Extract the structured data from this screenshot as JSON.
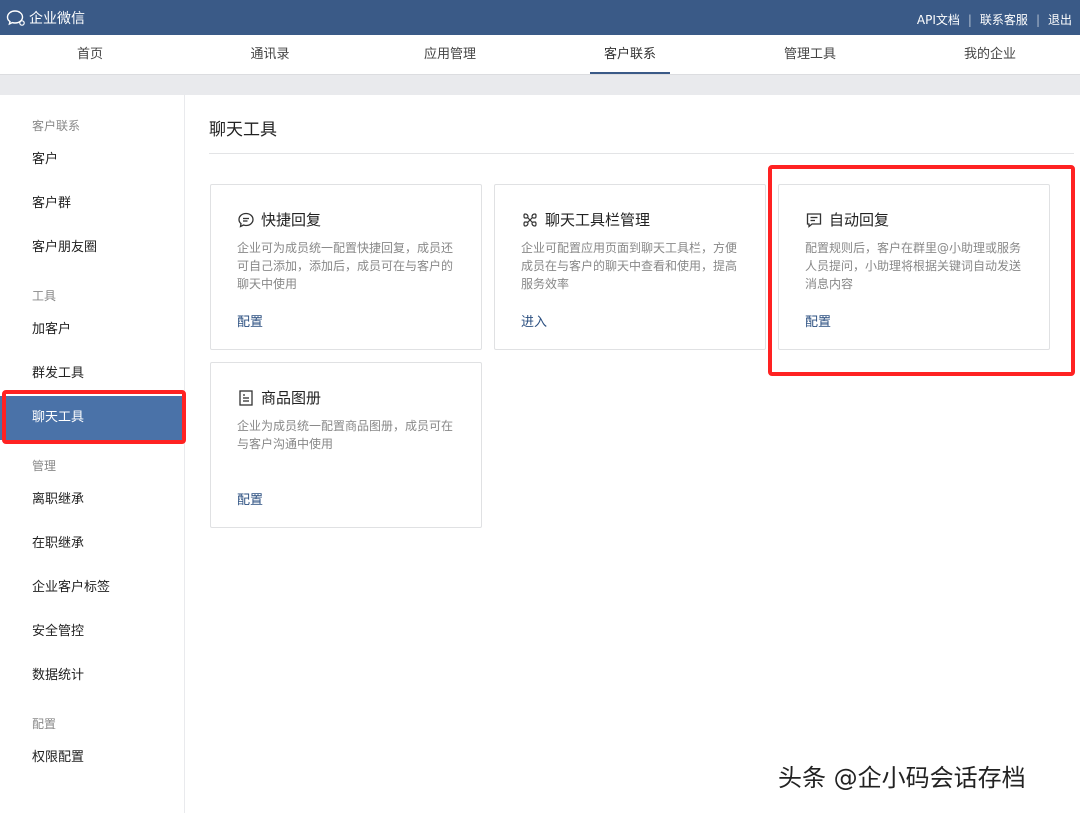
{
  "topbar": {
    "brand": "企业微信",
    "links": [
      "API文档",
      "联系客服",
      "退出"
    ]
  },
  "nav": {
    "items": [
      "首页",
      "通讯录",
      "应用管理",
      "客户联系",
      "管理工具",
      "我的企业"
    ],
    "active": "客户联系"
  },
  "sidebar": {
    "sections": [
      {
        "title": "客户联系",
        "items": [
          "客户",
          "客户群",
          "客户朋友圈"
        ]
      },
      {
        "title": "工具",
        "items": [
          "加客户",
          "群发工具",
          "聊天工具"
        ]
      },
      {
        "title": "管理",
        "items": [
          "离职继承",
          "在职继承",
          "企业客户标签",
          "安全管控",
          "数据统计"
        ]
      },
      {
        "title": "配置",
        "items": [
          "权限配置"
        ]
      }
    ],
    "active": "聊天工具"
  },
  "main": {
    "title": "聊天工具",
    "cards": [
      {
        "icon": "quick-reply-icon",
        "title": "快捷回复",
        "desc": "企业可为成员统一配置快捷回复，成员还可自己添加，添加后，成员可在与客户的聊天中使用",
        "action": "配置"
      },
      {
        "icon": "toolbar-icon",
        "title": "聊天工具栏管理",
        "desc": "企业可配置应用页面到聊天工具栏，方便成员在与客户的聊天中查看和使用，提高服务效率",
        "action": "进入"
      },
      {
        "icon": "auto-reply-icon",
        "title": "自动回复",
        "desc": "配置规则后，客户在群里@小助理或服务人员提问，小助理将根据关键词自动发送消息内容",
        "action": "配置"
      },
      {
        "icon": "catalog-icon",
        "title": "商品图册",
        "desc": "企业为成员统一配置商品图册，成员可在与客户沟通中使用",
        "action": "配置"
      }
    ]
  },
  "watermark": "头条 @企小码会话存档",
  "colors": {
    "topbar": "#3a5a87",
    "sidebar_active": "#4a72a8",
    "link": "#2b4f80",
    "highlight": "#ff2222"
  }
}
